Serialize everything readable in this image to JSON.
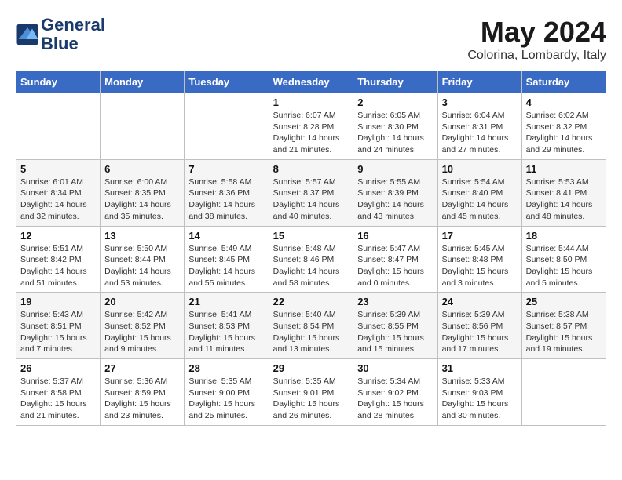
{
  "header": {
    "logo_line1": "General",
    "logo_line2": "Blue",
    "month_title": "May 2024",
    "subtitle": "Colorina, Lombardy, Italy"
  },
  "days_of_week": [
    "Sunday",
    "Monday",
    "Tuesday",
    "Wednesday",
    "Thursday",
    "Friday",
    "Saturday"
  ],
  "weeks": [
    [
      {
        "day": "",
        "info": ""
      },
      {
        "day": "",
        "info": ""
      },
      {
        "day": "",
        "info": ""
      },
      {
        "day": "1",
        "info": "Sunrise: 6:07 AM\nSunset: 8:28 PM\nDaylight: 14 hours\nand 21 minutes."
      },
      {
        "day": "2",
        "info": "Sunrise: 6:05 AM\nSunset: 8:30 PM\nDaylight: 14 hours\nand 24 minutes."
      },
      {
        "day": "3",
        "info": "Sunrise: 6:04 AM\nSunset: 8:31 PM\nDaylight: 14 hours\nand 27 minutes."
      },
      {
        "day": "4",
        "info": "Sunrise: 6:02 AM\nSunset: 8:32 PM\nDaylight: 14 hours\nand 29 minutes."
      }
    ],
    [
      {
        "day": "5",
        "info": "Sunrise: 6:01 AM\nSunset: 8:34 PM\nDaylight: 14 hours\nand 32 minutes."
      },
      {
        "day": "6",
        "info": "Sunrise: 6:00 AM\nSunset: 8:35 PM\nDaylight: 14 hours\nand 35 minutes."
      },
      {
        "day": "7",
        "info": "Sunrise: 5:58 AM\nSunset: 8:36 PM\nDaylight: 14 hours\nand 38 minutes."
      },
      {
        "day": "8",
        "info": "Sunrise: 5:57 AM\nSunset: 8:37 PM\nDaylight: 14 hours\nand 40 minutes."
      },
      {
        "day": "9",
        "info": "Sunrise: 5:55 AM\nSunset: 8:39 PM\nDaylight: 14 hours\nand 43 minutes."
      },
      {
        "day": "10",
        "info": "Sunrise: 5:54 AM\nSunset: 8:40 PM\nDaylight: 14 hours\nand 45 minutes."
      },
      {
        "day": "11",
        "info": "Sunrise: 5:53 AM\nSunset: 8:41 PM\nDaylight: 14 hours\nand 48 minutes."
      }
    ],
    [
      {
        "day": "12",
        "info": "Sunrise: 5:51 AM\nSunset: 8:42 PM\nDaylight: 14 hours\nand 51 minutes."
      },
      {
        "day": "13",
        "info": "Sunrise: 5:50 AM\nSunset: 8:44 PM\nDaylight: 14 hours\nand 53 minutes."
      },
      {
        "day": "14",
        "info": "Sunrise: 5:49 AM\nSunset: 8:45 PM\nDaylight: 14 hours\nand 55 minutes."
      },
      {
        "day": "15",
        "info": "Sunrise: 5:48 AM\nSunset: 8:46 PM\nDaylight: 14 hours\nand 58 minutes."
      },
      {
        "day": "16",
        "info": "Sunrise: 5:47 AM\nSunset: 8:47 PM\nDaylight: 15 hours\nand 0 minutes."
      },
      {
        "day": "17",
        "info": "Sunrise: 5:45 AM\nSunset: 8:48 PM\nDaylight: 15 hours\nand 3 minutes."
      },
      {
        "day": "18",
        "info": "Sunrise: 5:44 AM\nSunset: 8:50 PM\nDaylight: 15 hours\nand 5 minutes."
      }
    ],
    [
      {
        "day": "19",
        "info": "Sunrise: 5:43 AM\nSunset: 8:51 PM\nDaylight: 15 hours\nand 7 minutes."
      },
      {
        "day": "20",
        "info": "Sunrise: 5:42 AM\nSunset: 8:52 PM\nDaylight: 15 hours\nand 9 minutes."
      },
      {
        "day": "21",
        "info": "Sunrise: 5:41 AM\nSunset: 8:53 PM\nDaylight: 15 hours\nand 11 minutes."
      },
      {
        "day": "22",
        "info": "Sunrise: 5:40 AM\nSunset: 8:54 PM\nDaylight: 15 hours\nand 13 minutes."
      },
      {
        "day": "23",
        "info": "Sunrise: 5:39 AM\nSunset: 8:55 PM\nDaylight: 15 hours\nand 15 minutes."
      },
      {
        "day": "24",
        "info": "Sunrise: 5:39 AM\nSunset: 8:56 PM\nDaylight: 15 hours\nand 17 minutes."
      },
      {
        "day": "25",
        "info": "Sunrise: 5:38 AM\nSunset: 8:57 PM\nDaylight: 15 hours\nand 19 minutes."
      }
    ],
    [
      {
        "day": "26",
        "info": "Sunrise: 5:37 AM\nSunset: 8:58 PM\nDaylight: 15 hours\nand 21 minutes."
      },
      {
        "day": "27",
        "info": "Sunrise: 5:36 AM\nSunset: 8:59 PM\nDaylight: 15 hours\nand 23 minutes."
      },
      {
        "day": "28",
        "info": "Sunrise: 5:35 AM\nSunset: 9:00 PM\nDaylight: 15 hours\nand 25 minutes."
      },
      {
        "day": "29",
        "info": "Sunrise: 5:35 AM\nSunset: 9:01 PM\nDaylight: 15 hours\nand 26 minutes."
      },
      {
        "day": "30",
        "info": "Sunrise: 5:34 AM\nSunset: 9:02 PM\nDaylight: 15 hours\nand 28 minutes."
      },
      {
        "day": "31",
        "info": "Sunrise: 5:33 AM\nSunset: 9:03 PM\nDaylight: 15 hours\nand 30 minutes."
      },
      {
        "day": "",
        "info": ""
      }
    ]
  ]
}
